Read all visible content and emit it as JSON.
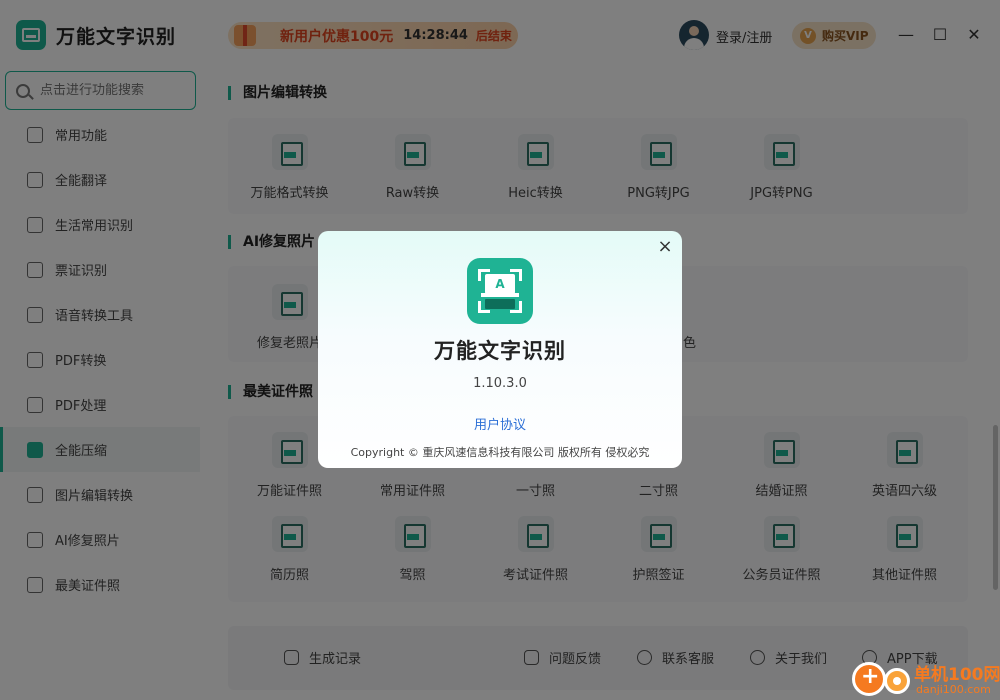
{
  "app": {
    "title": "万能文字识别"
  },
  "promo": {
    "title": "新用户优惠100元",
    "countdown": "14:28:44",
    "suffix": "后结束"
  },
  "header": {
    "login_label": "登录/注册",
    "vip_label": "购买VIP",
    "vip_badge": "V"
  },
  "window_controls": {
    "minimize": "—",
    "maximize": "☐",
    "close": "✕"
  },
  "search": {
    "placeholder": "点击进行功能搜索"
  },
  "sidebar": {
    "items": [
      {
        "label": "常用功能"
      },
      {
        "label": "全能翻译"
      },
      {
        "label": "生活常用识别"
      },
      {
        "label": "票证识别"
      },
      {
        "label": "语音转换工具"
      },
      {
        "label": "PDF转换"
      },
      {
        "label": "PDF处理"
      },
      {
        "label": "全能压缩",
        "active": true
      },
      {
        "label": "图片编辑转换"
      },
      {
        "label": "AI修复照片"
      },
      {
        "label": "最美证件照"
      }
    ]
  },
  "sections": {
    "image_edit": {
      "title": "图片编辑转换",
      "tools": [
        "万能格式转换",
        "Raw转换",
        "Heic转换",
        "PNG转JPG",
        "JPG转PNG"
      ]
    },
    "ai_repair": {
      "title": "AI修复照片",
      "tools": [
        "修复老照片",
        "色"
      ]
    },
    "id_photo": {
      "title": "最美证件照",
      "tools_row1": [
        "万能证件照",
        "常用证件照",
        "一寸照",
        "二寸照",
        "结婚证照",
        "英语四六级"
      ],
      "tools_row2": [
        "简历照",
        "驾照",
        "考试证件照",
        "护照签证",
        "公务员证件照",
        "其他证件照"
      ]
    }
  },
  "footer": {
    "history": "生成记录",
    "feedback": "问题反馈",
    "service": "联系客服",
    "about": "关于我们",
    "app_download": "APP下载"
  },
  "dialog": {
    "close": "×",
    "logo_letter": "A",
    "app_name": "万能文字识别",
    "version": "1.10.3.0",
    "agreement_link": "用户协议",
    "copyright": "Copyright © 重庆风速信息科技有限公司 版权所有 侵权必究"
  },
  "watermark": {
    "name": "单机100网",
    "url": "danji100.com"
  },
  "colors": {
    "accent": "#1fb394",
    "promo_text": "#e0441e",
    "link": "#2b6fd6"
  }
}
